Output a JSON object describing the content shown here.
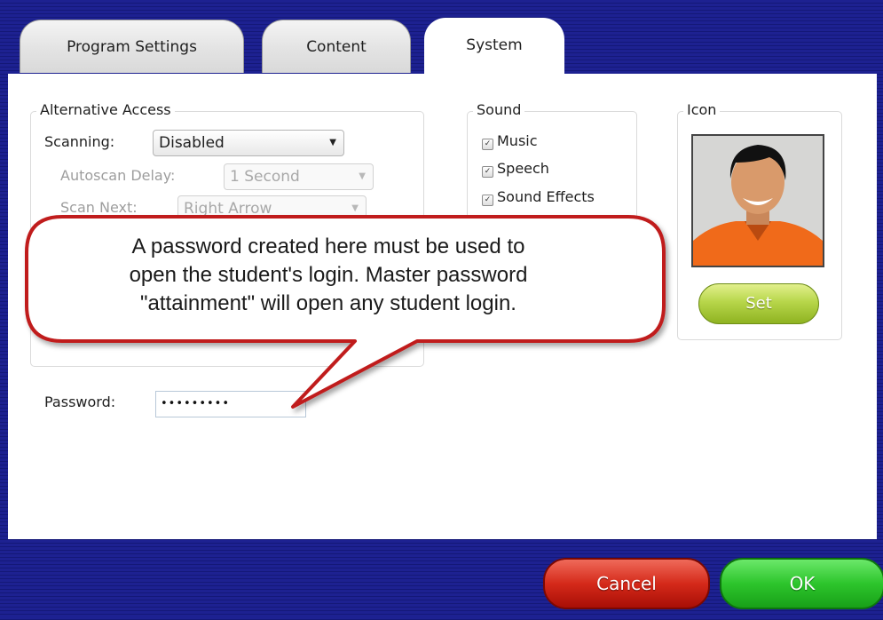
{
  "tabs": [
    {
      "label": "Program Settings"
    },
    {
      "label": "Content"
    },
    {
      "label": "System"
    }
  ],
  "alt_access": {
    "legend": "Alternative Access",
    "scanning_label": "Scanning:",
    "scanning_value": "Disabled",
    "autoscan_label": "Autoscan Delay:",
    "autoscan_value": "1 Second",
    "scannext_label": "Scan Next:",
    "scannext_value": "Right Arrow"
  },
  "sound": {
    "legend": "Sound",
    "items": [
      {
        "label": "Music",
        "checked": true
      },
      {
        "label": "Speech",
        "checked": true
      },
      {
        "label": "Sound Effects",
        "checked": true
      }
    ]
  },
  "icon_group": {
    "legend": "Icon",
    "set_label": "Set"
  },
  "password": {
    "label": "Password:",
    "value": "•••••••••"
  },
  "callout": {
    "line1": "A password created here must be used to",
    "line2": "open the student's login. Master password",
    "line3": "\"attainment\" will open any student login."
  },
  "footer": {
    "cancel_label": "Cancel",
    "ok_label": "OK"
  },
  "colors": {
    "background": "#1b1f8a",
    "cancel": "#d52a1a",
    "ok": "#2dc52c",
    "set": "#b7d64a",
    "callout_border": "#c01c1c"
  }
}
